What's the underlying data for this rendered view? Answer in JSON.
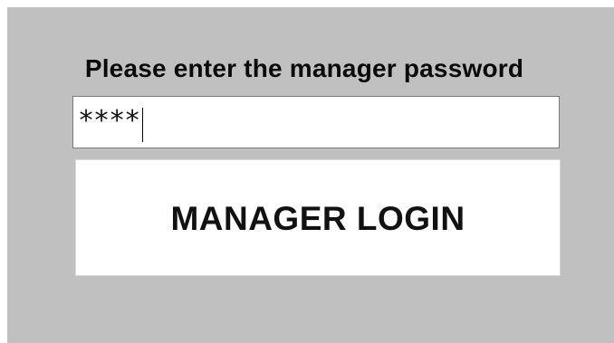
{
  "dialog": {
    "prompt": "Please enter the manager password",
    "password_field": {
      "masked_value": "****"
    },
    "login_button": {
      "label": "MANAGER LOGIN"
    }
  },
  "colors": {
    "panel_background": "#c0c0c0",
    "field_background": "#ffffff",
    "button_background": "#ffffff",
    "text": "#111111"
  }
}
